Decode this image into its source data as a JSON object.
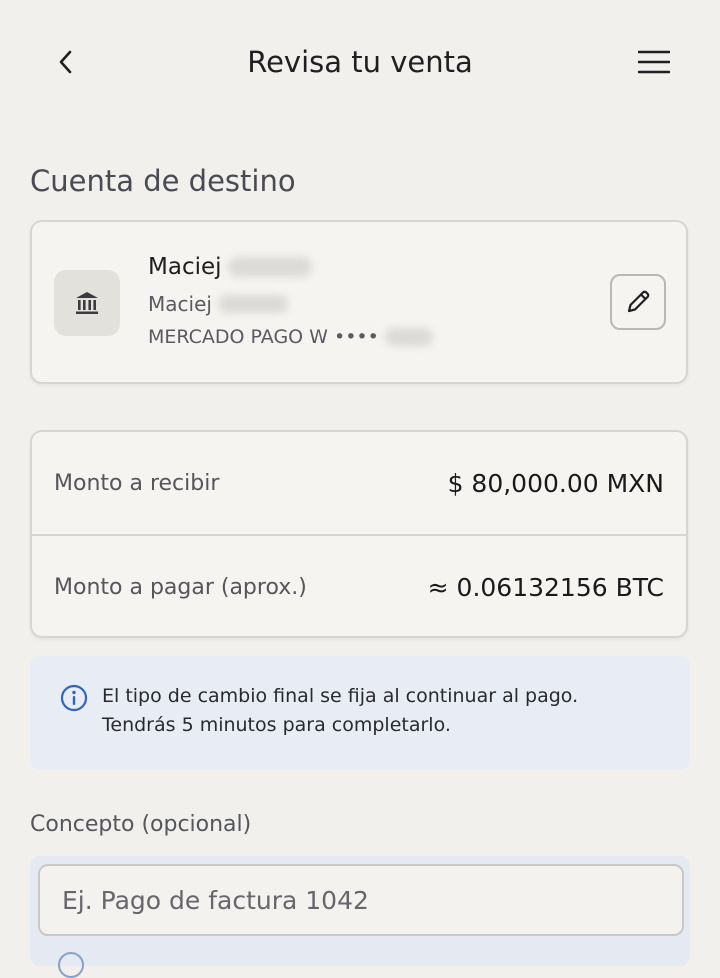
{
  "header": {
    "title": "Revisa tu venta",
    "back_icon": "chevron-left-icon",
    "menu_icon": "hamburger-menu-icon"
  },
  "destination": {
    "section_title": "Cuenta de destino",
    "bank_icon": "bank-icon",
    "name": "Maciej",
    "holder": "Maciej",
    "bank_line": "MERCADO PAGO W ••••",
    "edit_icon": "pencil-icon"
  },
  "amounts": {
    "receive_label": "Monto a recibir",
    "receive_value": "$ 80,000.00 MXN",
    "pay_label": "Monto a pagar (aprox.)",
    "pay_value": "≈ 0.06132156 BTC"
  },
  "info": {
    "icon": "info-icon",
    "line1": "El tipo de cambio final se fija al continuar al pago.",
    "line2": "Tendrás 5 minutos para completarlo."
  },
  "concept": {
    "label": "Concepto (opcional)",
    "placeholder": "Ej. Pago de factura 1042",
    "value": ""
  },
  "colors": {
    "background": "#f1f0ed",
    "info_background": "#e8ecf4",
    "info_accent": "#2f63c6"
  }
}
